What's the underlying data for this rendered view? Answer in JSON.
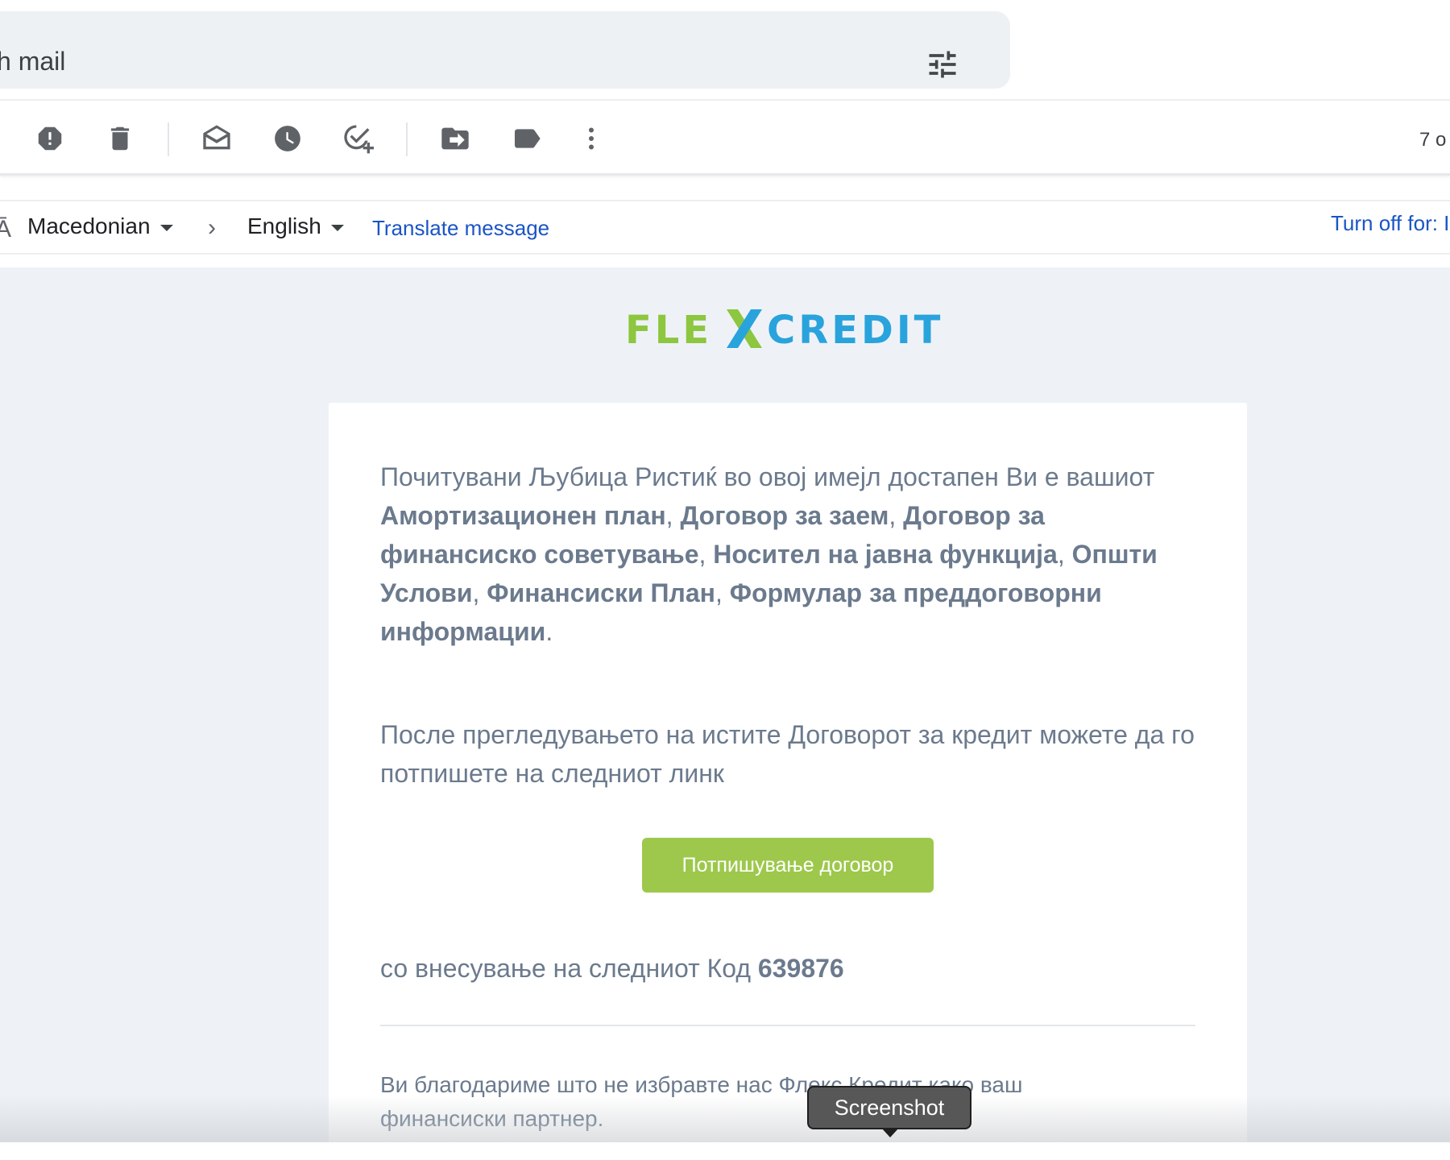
{
  "search": {
    "text": "ch mail"
  },
  "toolbar": {
    "count_text": "7 o"
  },
  "translate_bar": {
    "from_language": "Macedonian",
    "to_language": "English",
    "translate_link": "Translate message",
    "turn_off_link": "Turn off for: I"
  },
  "email": {
    "logo": {
      "part1": "FLEX",
      "part2": "CREDIT",
      "green": "#8dc63f",
      "blue": "#29a3dc"
    },
    "greeting_lead": "Почитувани Љубица Ристиќ во овој имејл достапен Ви е вашиот ",
    "documents": [
      "Амортизационен план",
      "Договор за заем",
      "Договор за финансиско советување",
      "Носител на јавна функција",
      "Општи Услови",
      "Финансиски План",
      "Формулар за преддоговорни информации"
    ],
    "separator": ", ",
    "period": ".",
    "para2": "После прегледувањето на истите Договорот за кредит можете да го потпишете на следниот линк",
    "sign_button": "Потпишување договор",
    "code_lead": "со внесување на следниот Код ",
    "code": "639876",
    "thanks": "Ви благодариме што не избравте нас Флекс Кредит како ваш финансиски партнер."
  },
  "tooltip": {
    "text": "Screenshot"
  },
  "colors": {
    "link": "#1a55c5",
    "button_green": "#9dc84c",
    "body_text": "#6b7a8d",
    "email_bg": "#eef2f7"
  }
}
